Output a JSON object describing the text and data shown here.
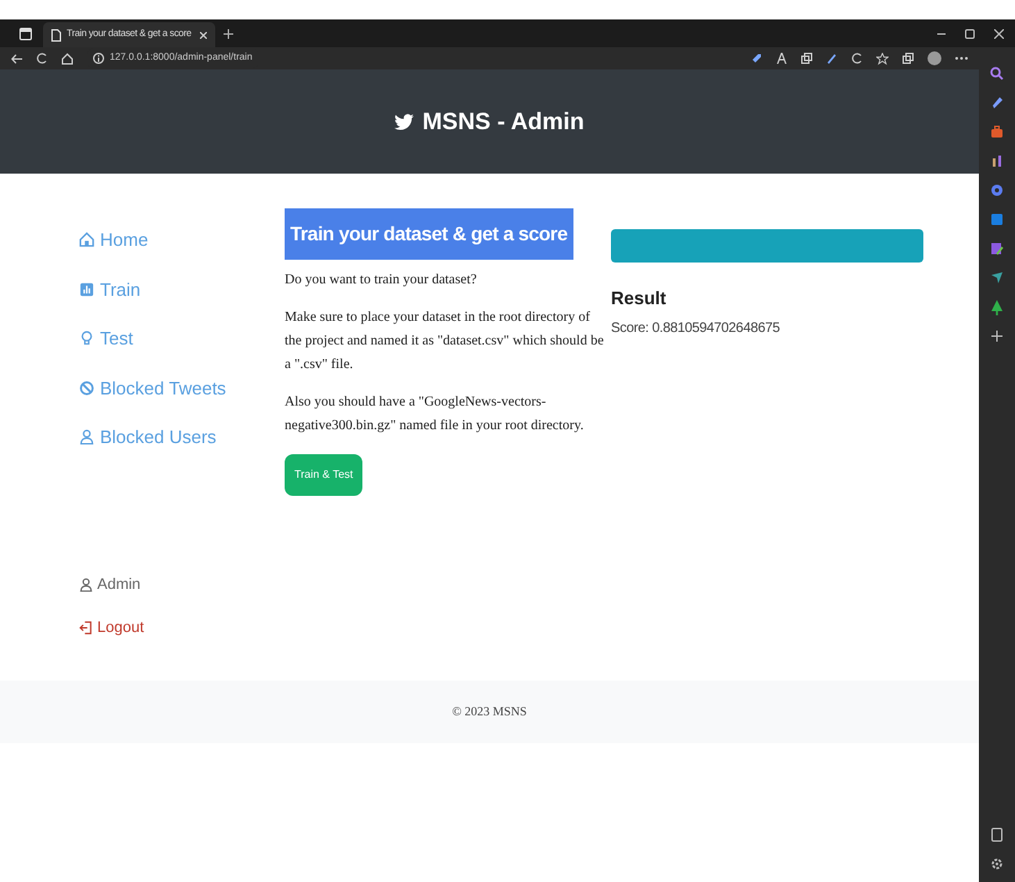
{
  "browser": {
    "tab_title": "Train your dataset & get a score",
    "address": "127.0.0.1:8000/admin-panel/train"
  },
  "header": {
    "title": "MSNS - Admin"
  },
  "nav": [
    {
      "label": "Home",
      "kind": "home"
    },
    {
      "label": "Train",
      "kind": "chart"
    },
    {
      "label": "Test",
      "kind": "bulb"
    },
    {
      "label": "Blocked Tweets",
      "kind": "ban"
    },
    {
      "label": "Blocked Users",
      "kind": "user"
    }
  ],
  "account": [
    {
      "label": "Admin",
      "kind": "user"
    },
    {
      "label": "Logout",
      "kind": "logout"
    }
  ],
  "main": {
    "title": "Train your dataset & get a score",
    "paragraphs": [
      "Do you want to train your dataset?",
      "Make sure to place your dataset in the root directory of the project and named it as \"dataset.csv\" which should be a \".csv\" file.",
      "Also you should have a \"GoogleNews-vectors-negative300.bin.gz\" named file in your root directory."
    ],
    "button": "Train & Test"
  },
  "result": {
    "progress": {
      "level": 1
    },
    "heading": "Result",
    "score": "Score: 0.8810594702648675"
  },
  "footer": "© 2023 MSNS"
}
